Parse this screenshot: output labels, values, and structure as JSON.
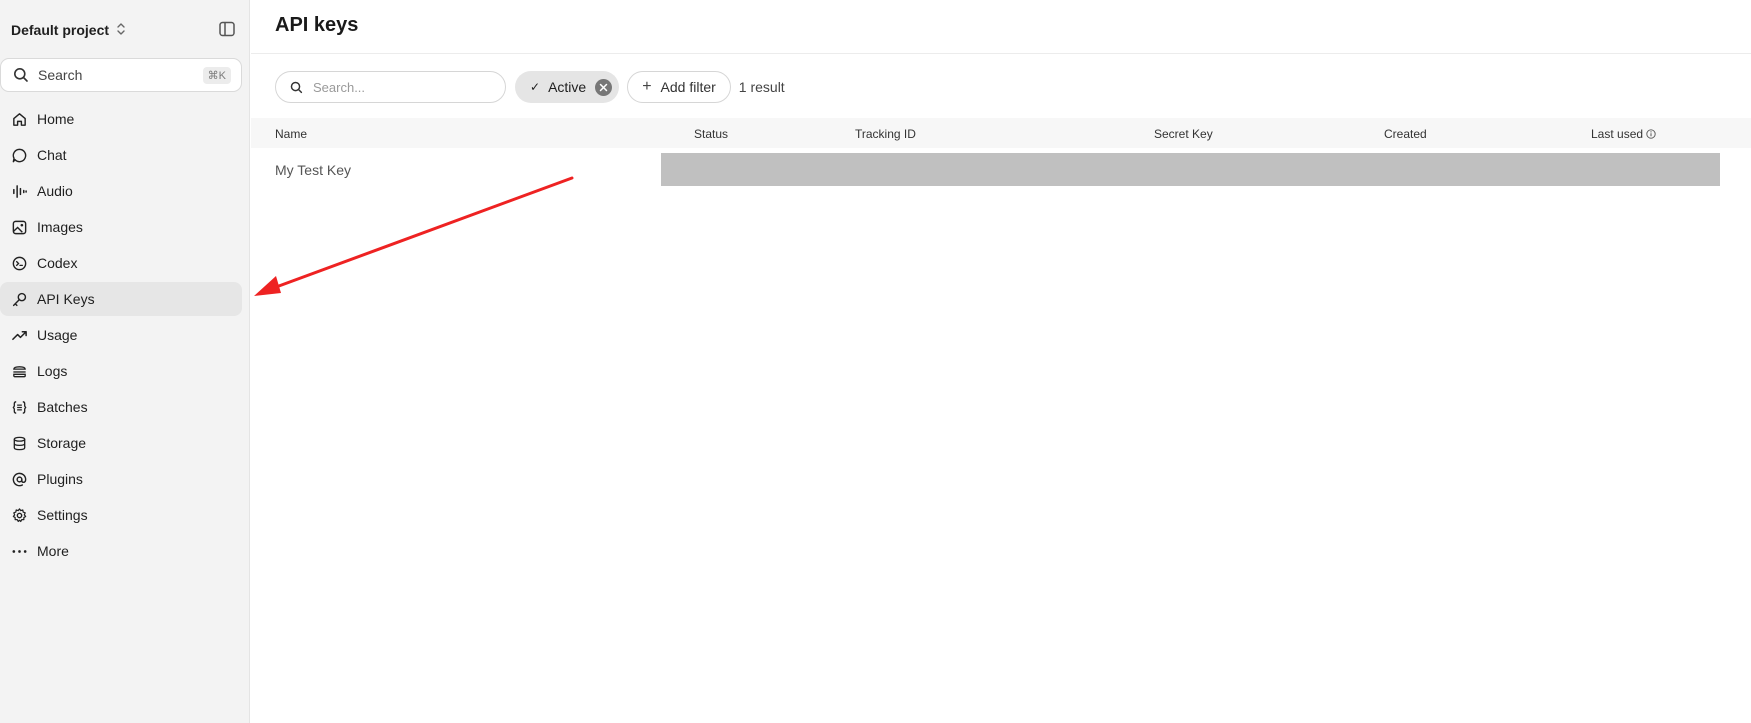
{
  "sidebar": {
    "project_name": "Default project",
    "search_label": "Search",
    "search_shortcut": "⌘K",
    "nav": [
      {
        "label": "Home",
        "icon": "home-icon"
      },
      {
        "label": "Chat",
        "icon": "chat-bubble-icon"
      },
      {
        "label": "Audio",
        "icon": "audio-waveform-icon"
      },
      {
        "label": "Images",
        "icon": "image-icon"
      },
      {
        "label": "Codex",
        "icon": "codex-terminal-icon"
      },
      {
        "label": "API Keys",
        "icon": "key-icon",
        "active": true
      },
      {
        "label": "Usage",
        "icon": "trending-up-icon"
      },
      {
        "label": "Logs",
        "icon": "logs-stack-icon"
      },
      {
        "label": "Batches",
        "icon": "batches-braces-icon"
      },
      {
        "label": "Storage",
        "icon": "database-icon"
      },
      {
        "label": "Plugins",
        "icon": "plugin-at-icon"
      },
      {
        "label": "Settings",
        "icon": "gear-icon"
      },
      {
        "label": "More",
        "icon": "more-dots-icon"
      }
    ]
  },
  "main": {
    "title": "API keys",
    "search_placeholder": "Search...",
    "active_filter_label": "Active",
    "add_filter_label": "Add filter",
    "result_count": "1 result",
    "columns": [
      "Name",
      "Status",
      "Tracking ID",
      "Secret Key",
      "Created",
      "Last used"
    ],
    "rows": [
      {
        "name": "My Test Key"
      }
    ]
  },
  "colors": {
    "sidebar_bg": "#f3f3f3",
    "active_item_bg": "#e6e6e6",
    "redaction": "#c0c0c0",
    "annotation_arrow": "#ee2222"
  }
}
